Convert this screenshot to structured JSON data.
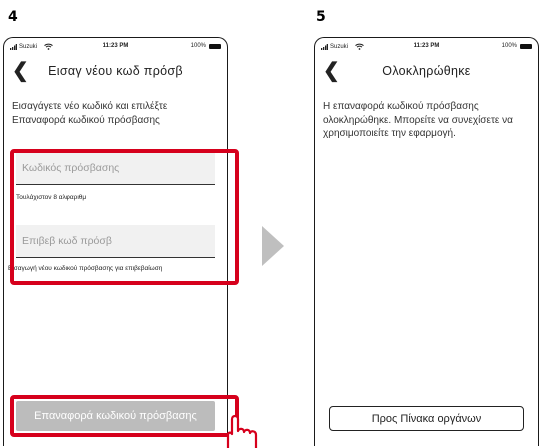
{
  "steps": {
    "left": {
      "number": "4",
      "status": {
        "carrier": "Suzuki",
        "time": "11:23 PM",
        "battery": "100%"
      },
      "title": "Εισαγ νέου κωδ πρόσβ",
      "instruction": "Εισαγάγετε νέο κωδικό και επιλέξτε Επαναφορά κωδικού πρόσβασης",
      "password_field": {
        "placeholder": "Κωδικός πρόσβασης",
        "helper": "Τουλάχιστον 8 αλφαριθμ"
      },
      "confirm_field": {
        "placeholder": "Επιβεβ κωδ πρόσβ",
        "helper": "Εισαγωγή νέου κωδικού πρόσβασης για επιβεβαίωση"
      },
      "reset_button": "Επαναφορά κωδικού πρόσβασης"
    },
    "right": {
      "number": "5",
      "status": {
        "carrier": "Suzuki",
        "time": "11:23 PM",
        "battery": "100%"
      },
      "title": "Ολοκληρώθηκε",
      "message": "Η επαναφορά κωδικού πρόσβασης ολοκληρώθηκε. Μπορείτε να συνεχίσετε να χρησιμοποιείτε την εφαρμογή.",
      "dashboard_button": "Προς Πίνακα οργάνων"
    }
  },
  "colors": {
    "highlight": "#d6001c",
    "disabled_button": "#bcbcbc",
    "arrow": "#bfbfbf"
  },
  "icons": {
    "back": "chevron-left-icon",
    "wifi": "wifi-icon",
    "signal": "signal-icon",
    "battery": "battery-icon",
    "pointer": "hand-pointer-icon"
  }
}
